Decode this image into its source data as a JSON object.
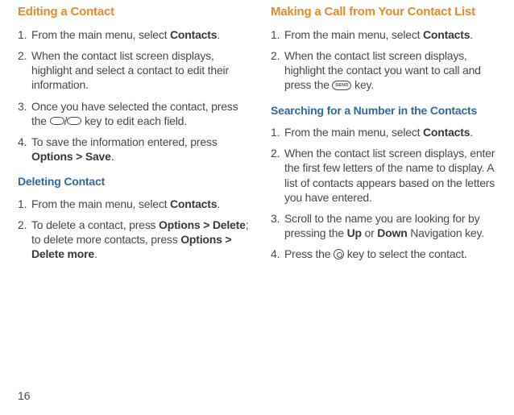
{
  "page_number": "16",
  "left": {
    "section1": {
      "title": "Editing a Contact",
      "items": [
        {
          "pre": "From the main menu, select ",
          "bold": "Contacts",
          "post": "."
        },
        {
          "pre": "When the contact list screen displays, highlight and select a contact to edit their information.",
          "bold": "",
          "post": ""
        },
        {
          "pre": "Once you have selected the contact, press the ",
          "mid": "/",
          "post2": " key to edit each field.",
          "key1": true,
          "key2": true
        },
        {
          "pre": "To save the information entered, press ",
          "bold": "Options > Save",
          "post": "."
        }
      ]
    },
    "section2": {
      "title": "Deleting Contact",
      "items": [
        {
          "pre": "From the main menu, select ",
          "bold": "Contacts",
          "post": "."
        },
        {
          "pre": "To delete a contact, press ",
          "bold": "Options > Delete",
          "post": "; to delete more contacts, press ",
          "bold2": "Options > Delete more",
          "post2": "."
        }
      ]
    }
  },
  "right": {
    "section1": {
      "title": "Making a Call from Your Contact List",
      "items": [
        {
          "pre": "From the main menu, select ",
          "bold": "Contacts",
          "post": "."
        },
        {
          "pre": "When the contact list screen displays, highlight the contact you want to call and press the ",
          "send": true,
          "post": " key."
        }
      ]
    },
    "section2": {
      "title": "Searching for a Number in the Contacts",
      "items": [
        {
          "pre": "From the main menu, select ",
          "bold": "Contacts",
          "post": "."
        },
        {
          "pre": "When the contact list screen displays, enter the first few letters of the name to display. A list of contacts appears based on the letters you have entered.",
          "bold": "",
          "post": ""
        },
        {
          "pre": "Scroll to the name you are looking for by pressing the ",
          "bold": "Up",
          "mid": " or ",
          "bold2": "Down",
          "post": " Navigation key."
        },
        {
          "pre": "Press the ",
          "round": true,
          "post": " key to select the contact."
        }
      ]
    }
  }
}
